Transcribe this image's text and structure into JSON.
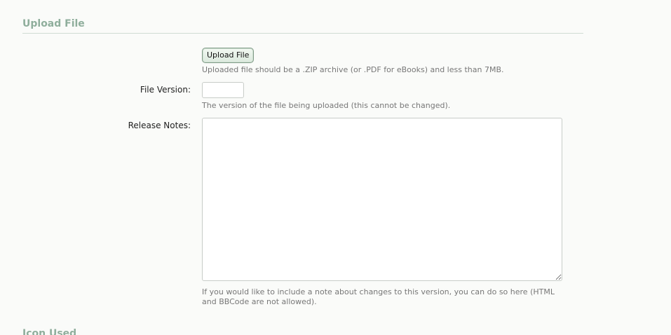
{
  "upload_section": {
    "heading": "Upload File",
    "upload_button_label": "Upload File",
    "upload_hint": "Uploaded file should be a .ZIP archive (or .PDF for eBooks) and less than 7MB."
  },
  "file_version": {
    "label": "File Version:",
    "value": "",
    "hint": "The version of the file being uploaded (this cannot be changed)."
  },
  "release_notes": {
    "label": "Release Notes:",
    "value": "",
    "hint": "If you would like to include a note about changes to this version, you can do so here (HTML and BBCode are not allowed)."
  },
  "next_section": {
    "heading": "Icon Used"
  }
}
